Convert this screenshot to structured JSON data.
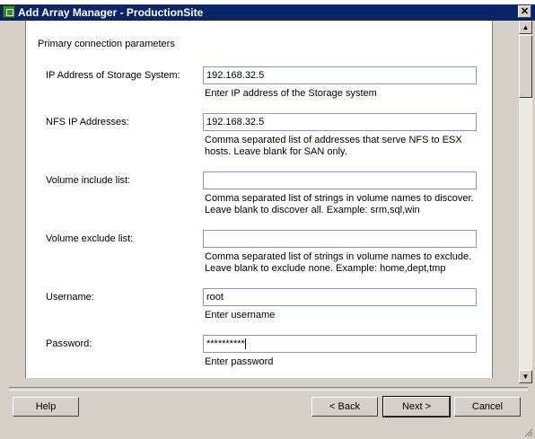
{
  "window": {
    "title": "Add Array Manager - ProductionSite"
  },
  "section_title": "Primary connection parameters",
  "fields": {
    "ip_address": {
      "label": "IP Address of Storage System:",
      "value": "192.168.32.5",
      "hint": "Enter IP address of the Storage system"
    },
    "nfs_ip": {
      "label": "NFS IP Addresses:",
      "value": "192.168.32.5",
      "hint": "Comma separated list of addresses that serve NFS to ESX hosts. Leave blank for SAN only."
    },
    "volume_include": {
      "label": "Volume include list:",
      "value": "",
      "hint": "Comma separated list of strings in volume names to discover. Leave blank to discover all. Example: srm,sql,win"
    },
    "volume_exclude": {
      "label": "Volume exclude list:",
      "value": "",
      "hint": "Comma separated list of strings in volume names to exclude. Leave blank to exclude none. Example: home,dept,tmp"
    },
    "username": {
      "label": "Username:",
      "value": "root",
      "hint": "Enter username"
    },
    "password": {
      "label": "Password:",
      "value": "**********",
      "hint": "Enter password"
    }
  },
  "buttons": {
    "help": "Help",
    "back": "< Back",
    "next": "Next >",
    "cancel": "Cancel"
  },
  "icons": {
    "close": "close-icon",
    "app": "app-icon",
    "scroll_up": "scroll-up-icon",
    "scroll_down": "scroll-down-icon"
  }
}
